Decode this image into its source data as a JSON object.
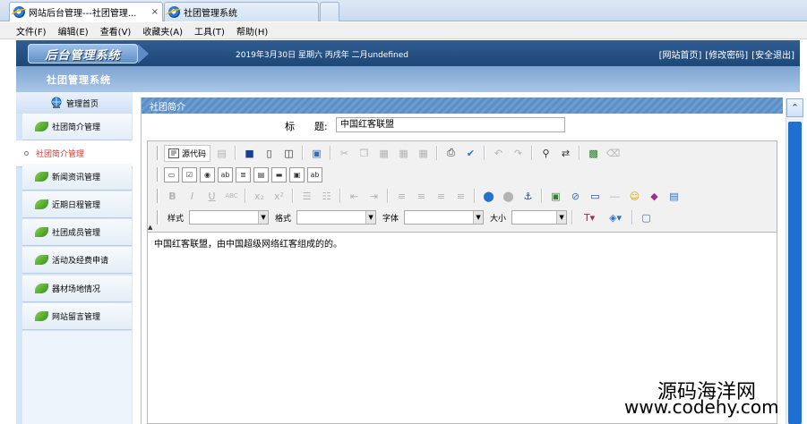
{
  "browser": {
    "tabs": [
      {
        "title": "网站后台管理---社团管理...",
        "close": "×"
      },
      {
        "title": "社团管理系统"
      }
    ]
  },
  "menu": [
    "文件(F)",
    "编辑(E)",
    "查看(V)",
    "收藏夹(A)",
    "工具(T)",
    "帮助(H)"
  ],
  "header": {
    "logo": "后台管理系统",
    "date": "2019年3月30日 星期六 丙戌年 二月undefined",
    "links": [
      "[网站首页]",
      "[修改密码]",
      "[安全退出]"
    ],
    "system_name": "社团管理系统"
  },
  "sidebar": {
    "home": "管理首页",
    "items": [
      {
        "label": "社团简介管理",
        "icon": "leaf-icon"
      },
      {
        "label": "社团简介管理",
        "icon": "dot-icon",
        "selected": true
      },
      {
        "label": "新闻资讯管理",
        "icon": "leaf-icon"
      },
      {
        "label": "近期日程管理",
        "icon": "leaf-icon"
      },
      {
        "label": "社团成员管理",
        "icon": "leaf-icon"
      },
      {
        "label": "活动及经费申请",
        "icon": "leaf-icon"
      },
      {
        "label": "器材场地情况",
        "icon": "leaf-icon"
      },
      {
        "label": "网站留言管理",
        "icon": "leaf-icon"
      }
    ]
  },
  "main": {
    "section_title": "社团简介",
    "title_label": "标　　题:",
    "title_value": "中国红客联盟",
    "editor": {
      "source_button": "源代码",
      "combo_labels": [
        "样式",
        "格式",
        "字体",
        "大小"
      ],
      "content": "中国红客联盟，由中国超级网络红客组成的的。"
    }
  },
  "watermark": {
    "line1": "源码海洋网",
    "line2": "www.codehy.com"
  }
}
